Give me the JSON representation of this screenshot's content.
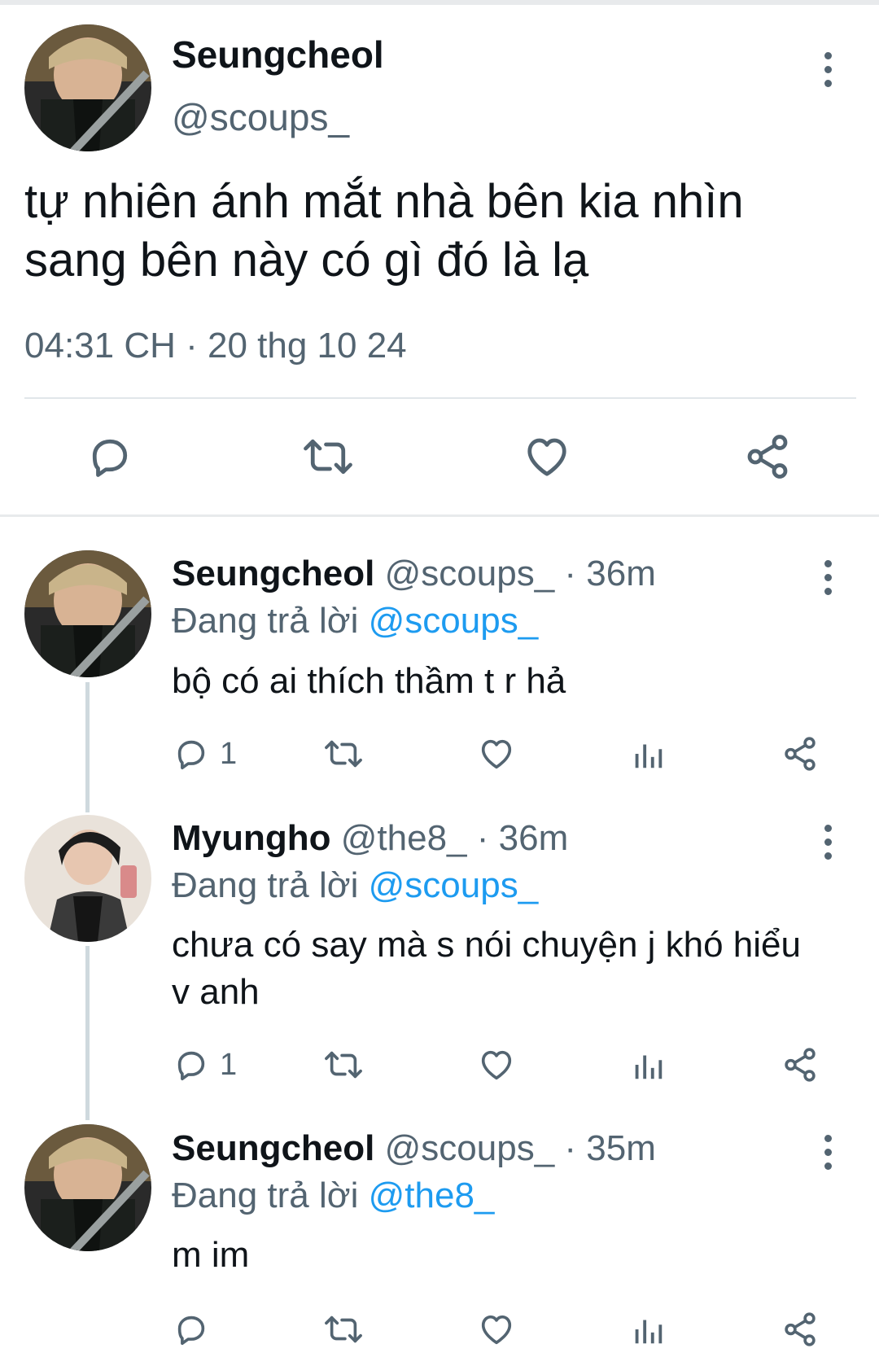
{
  "main_tweet": {
    "name": "Seungcheol",
    "handle": "@scoups_",
    "text": "tự nhiên ánh mắt nhà bên kia nhìn sang bên này có gì đó là lạ",
    "timestamp": "04:31 CH · 20 thg 10 24",
    "actions": [
      "reply-icon",
      "retweet-icon",
      "like-icon",
      "share-icon"
    ]
  },
  "replies": [
    {
      "name": "Seungcheol",
      "handle": "@scoups_",
      "time": "· 36m",
      "replying_label": "Đang trả lời",
      "replying_to": "@scoups_",
      "text": "bộ có ai thích thầm t r hả",
      "reply_count": "1"
    },
    {
      "name": "Myungho",
      "handle": "@the8_",
      "time": "· 36m",
      "replying_label": "Đang trả lời",
      "replying_to": "@scoups_",
      "text": "chưa có say mà s nói chuyện j khó hiểu v anh",
      "reply_count": "1"
    },
    {
      "name": "Seungcheol",
      "handle": "@scoups_",
      "time": "· 35m",
      "replying_label": "Đang trả lời",
      "replying_to": "@the8_",
      "text": "m im",
      "reply_count": ""
    }
  ],
  "colors": {
    "text": "#0f1419",
    "secondary": "#536471",
    "mention": "#1d9bf0",
    "divider": "#e1e6ea"
  }
}
